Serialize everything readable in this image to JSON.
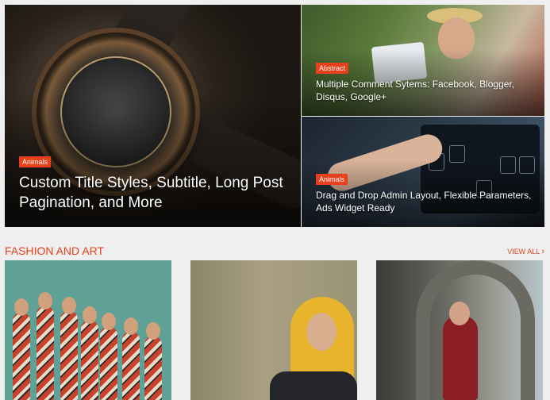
{
  "hero": {
    "main": {
      "badge": "Animals",
      "title": "Custom Title Styles, Subtitle, Long Post Pagination, and More"
    },
    "side_top": {
      "badge": "Abstract",
      "title": "Multiple Comment Sytems: Facebook, Blogger, Disqus, Google+"
    },
    "side_bottom": {
      "badge": "Animals",
      "title": "Drag and Drop Admin Layout, Flexible Parameters, Ads Widget Ready"
    }
  },
  "section": {
    "title": "FASHION AND ART",
    "view_all": "VIEW ALL",
    "view_all_icon": "chevron-right-icon"
  },
  "colors": {
    "accent": "#e8401a",
    "background": "#efefef"
  }
}
